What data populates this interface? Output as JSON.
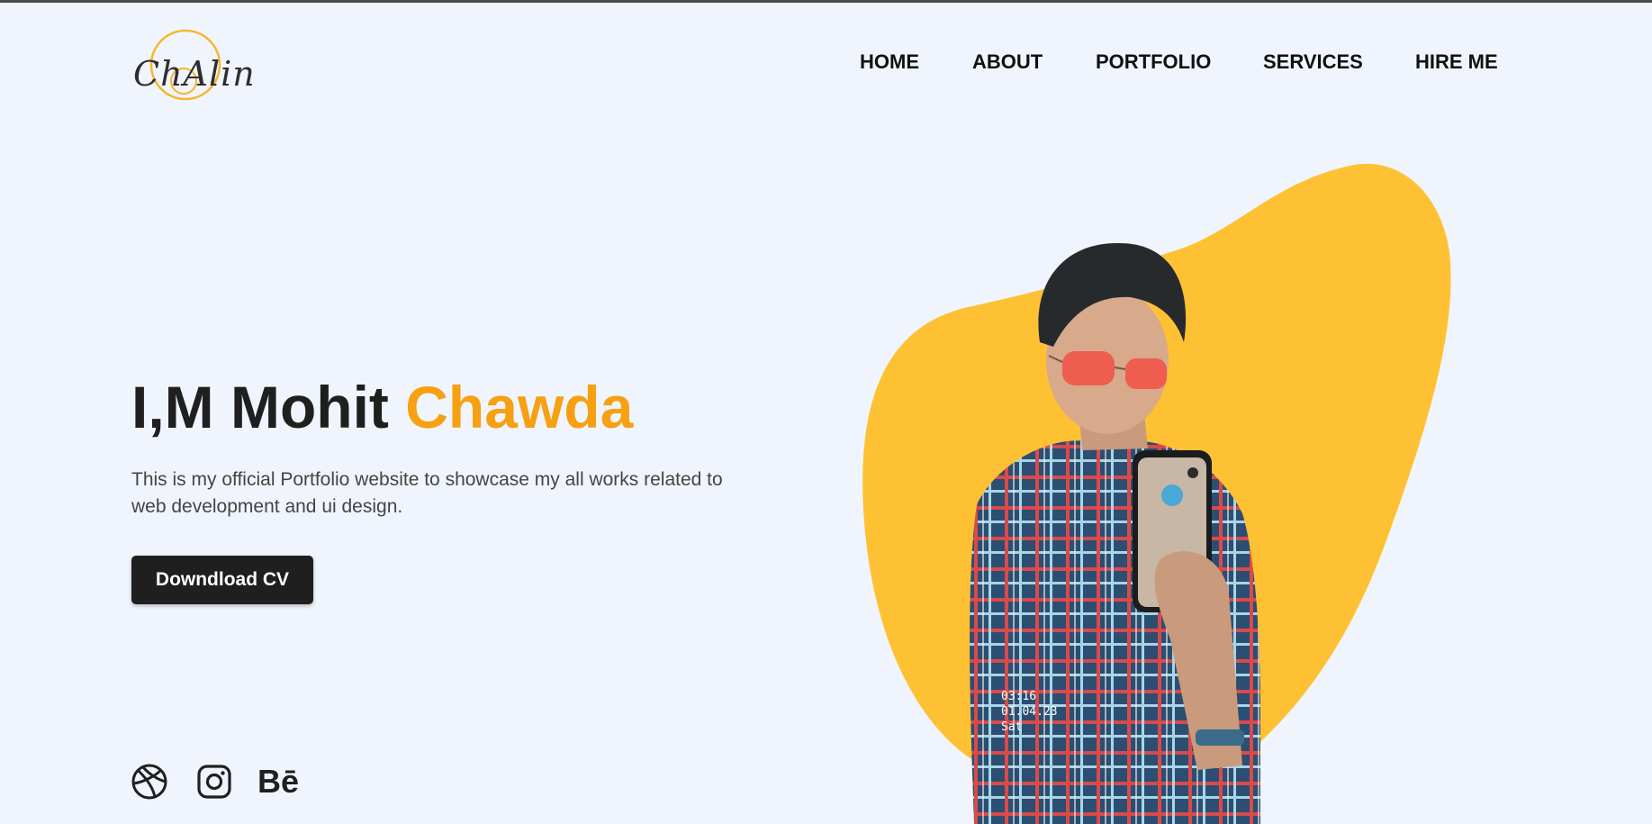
{
  "header": {
    "logo_text": "ChAlin",
    "nav": [
      "HOME",
      "ABOUT",
      "PORTFOLIO",
      "SERVICES",
      "HIRE ME"
    ]
  },
  "hero": {
    "title_prefix": "I,M Mohit ",
    "title_accent": "Chawda",
    "description": "This is my official Portfolio website to showcase my all works related to web development and ui design.",
    "cta_label": "Downdload CV",
    "photo_overlay": [
      "03:16",
      "01.04.23",
      "Sat"
    ]
  },
  "socials": {
    "icons": [
      "dribbble-icon",
      "instagram-icon",
      "behance-icon"
    ],
    "behance_label": "Bē"
  },
  "colors": {
    "background": "#f0f5fd",
    "accent_text": "#f6a012",
    "blob": "#fec134",
    "button": "#1f1f1f"
  }
}
